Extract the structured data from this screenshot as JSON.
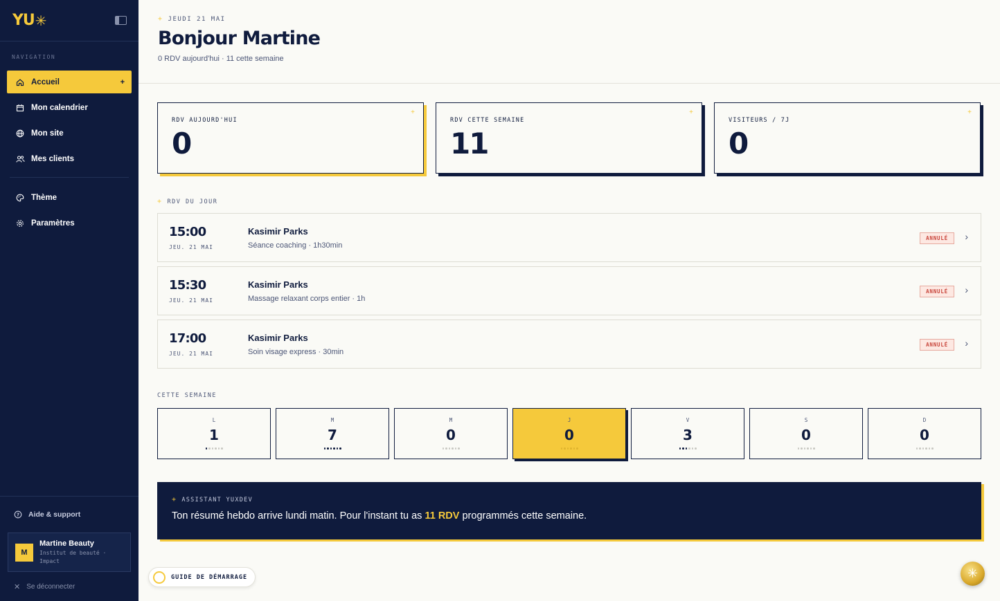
{
  "brand": {
    "logo": "YU",
    "logo_star": "✳"
  },
  "sidebar": {
    "nav_label": "NAVIGATION",
    "items": [
      {
        "label": "Accueil",
        "icon": "home-icon",
        "active": true,
        "plus": "+"
      },
      {
        "label": "Mon calendrier",
        "icon": "calendar-icon"
      },
      {
        "label": "Mon site",
        "icon": "globe-icon"
      },
      {
        "label": "Mes clients",
        "icon": "users-icon"
      }
    ],
    "items2": [
      {
        "label": "Thème",
        "icon": "palette-icon"
      },
      {
        "label": "Paramètres",
        "icon": "gear-icon"
      }
    ],
    "help": "Aide & support",
    "user": {
      "initial": "M",
      "name": "Martine Beauty",
      "sub": "Institut de beauté · Impact"
    },
    "logout": "Se déconnecter"
  },
  "header": {
    "date": "JEUDI 21 MAI",
    "greeting": "Bonjour Martine",
    "subline": "0 RDV aujourd'hui · 11 cette semaine"
  },
  "stats": [
    {
      "label": "RDV AUJOURD'HUI",
      "value": "0"
    },
    {
      "label": "RDV CETTE SEMAINE",
      "value": "11"
    },
    {
      "label": "VISITEURS / 7J",
      "value": "0"
    }
  ],
  "rdv_section": "RDV DU JOUR",
  "rdv": [
    {
      "time": "15:00",
      "date": "JEU. 21 MAI",
      "name": "Kasimir Parks",
      "service": "Séance coaching · 1h30min",
      "status": "ANNULÉ"
    },
    {
      "time": "15:30",
      "date": "JEU. 21 MAI",
      "name": "Kasimir Parks",
      "service": "Massage relaxant corps entier · 1h",
      "status": "ANNULÉ"
    },
    {
      "time": "17:00",
      "date": "JEU. 21 MAI",
      "name": "Kasimir Parks",
      "service": "Soin visage express · 30min",
      "status": "ANNULÉ"
    }
  ],
  "week_section": "CETTE SEMAINE",
  "week": [
    {
      "day": "L",
      "value": "1",
      "dots_on": 1
    },
    {
      "day": "M",
      "value": "7",
      "dots_on": 6
    },
    {
      "day": "M",
      "value": "0",
      "dots_on": 0
    },
    {
      "day": "J",
      "value": "0",
      "dots_on": 0,
      "today": true
    },
    {
      "day": "V",
      "value": "3",
      "dots_on": 3
    },
    {
      "day": "S",
      "value": "0",
      "dots_on": 0
    },
    {
      "day": "D",
      "value": "0",
      "dots_on": 0
    }
  ],
  "assistant": {
    "label": "ASSISTANT YUXDEV",
    "msg_pre": "Ton résumé hebdo arrive lundi matin. Pour l'instant tu as ",
    "msg_hl": "11 RDV",
    "msg_post": " programmés cette semaine."
  },
  "guide": "GUIDE DE DÉMARRAGE",
  "colors": {
    "navy": "#0f1b3d",
    "yellow": "#f5c93b",
    "danger": "#c8443a"
  }
}
